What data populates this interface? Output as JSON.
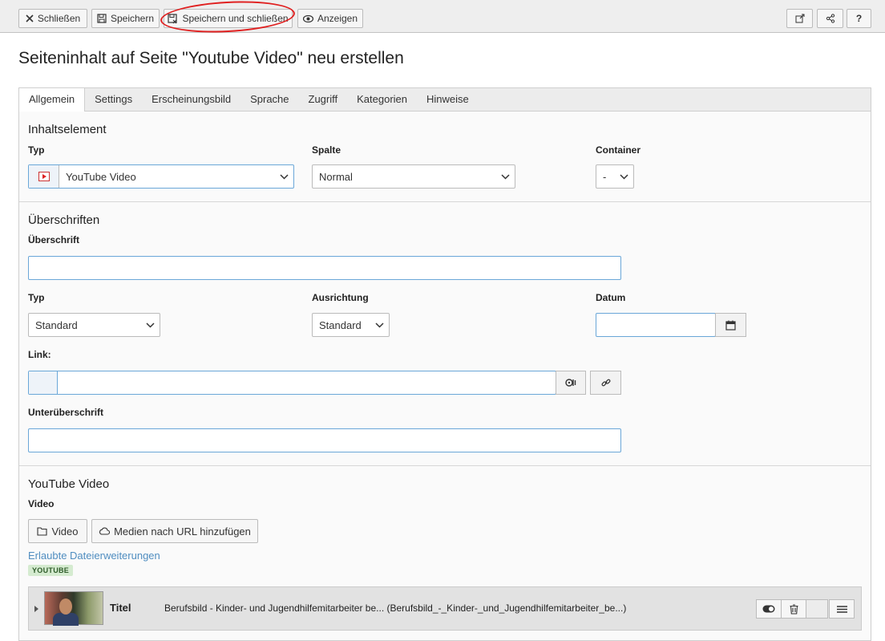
{
  "toolbar": {
    "close_label": "Schließen",
    "save_label": "Speichern",
    "save_close_label": "Speichern und schließen",
    "view_label": "Anzeigen",
    "help_label": "?"
  },
  "page": {
    "title": "Seiteninhalt auf Seite \"Youtube Video\" neu erstellen"
  },
  "tabs": [
    {
      "label": "Allgemein",
      "active": true
    },
    {
      "label": "Settings"
    },
    {
      "label": "Erscheinungsbild"
    },
    {
      "label": "Sprache"
    },
    {
      "label": "Zugriff"
    },
    {
      "label": "Kategorien"
    },
    {
      "label": "Hinweise"
    }
  ],
  "content_element": {
    "section_title": "Inhaltselement",
    "type_label": "Typ",
    "type_value": "YouTube Video",
    "column_label": "Spalte",
    "column_value": "Normal",
    "container_label": "Container",
    "container_value": "-"
  },
  "headings": {
    "section_title": "Überschriften",
    "heading_label": "Überschrift",
    "heading_value": "",
    "type_label": "Typ",
    "type_value": "Standard",
    "align_label": "Ausrichtung",
    "align_value": "Standard",
    "date_label": "Datum",
    "date_value": "",
    "link_label": "Link:",
    "link_value": "",
    "subheading_label": "Unterüberschrift",
    "subheading_value": ""
  },
  "youtube": {
    "section_title": "YouTube Video",
    "video_label": "Video",
    "video_button": "Video",
    "url_button": "Medien nach URL hinzufügen",
    "allowed_ext_link": "Erlaubte Dateierweiterungen",
    "ext_badge": "YOUTUBE",
    "file": {
      "title_label": "Titel",
      "title_value": "Berufsbild - Kinder- und Jugendhilfemitarbeiter be... (Berufsbild_-_Kinder-_und_Jugendhilfemitarbeiter_be...)"
    }
  },
  "colors": {
    "accent": "#4f8dc0",
    "annotation": "#e02020",
    "badge_bg": "#d5ebd0"
  }
}
